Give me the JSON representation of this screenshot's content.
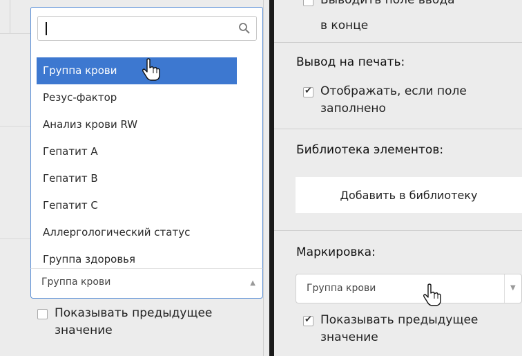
{
  "left": {
    "search": {
      "value": "",
      "placeholder": ""
    },
    "options": [
      "Группа крови",
      "Резус-фактор",
      "Анализ крови RW",
      "Гепатит A",
      "Гепатит B",
      "Гепатит C",
      "Аллергологический статус",
      "Группа здоровья"
    ],
    "selected_index": 0,
    "combo_value": "Группа крови",
    "show_previous": {
      "label_line1": "Показывать предыдущее",
      "label_line2": "значение",
      "checked": false
    }
  },
  "right": {
    "input_at_end": {
      "line1": "Выводить поле ввода",
      "line2": "в конце"
    },
    "print_section": {
      "title": "Вывод на печать:",
      "show_if_filled": {
        "line1": "Отображать, если поле",
        "line2": "заполнено",
        "checked": true
      }
    },
    "library_section": {
      "title": "Библиотека элементов:",
      "button_label": "Добавить в библиотеку"
    },
    "marking_section": {
      "title": "Маркировка:",
      "select_value": "Группа крови",
      "show_previous": {
        "label_line1": "Показывать предыдущее",
        "label_line2": "значение",
        "checked": true
      }
    }
  },
  "colors": {
    "selection": "#3d78d0",
    "focus_border": "#5b8fd6",
    "divider": "#1a1a1a",
    "panel_bg": "#ececec"
  },
  "icons": {
    "search": "search-icon",
    "cursor": "hand-pointer-icon"
  }
}
